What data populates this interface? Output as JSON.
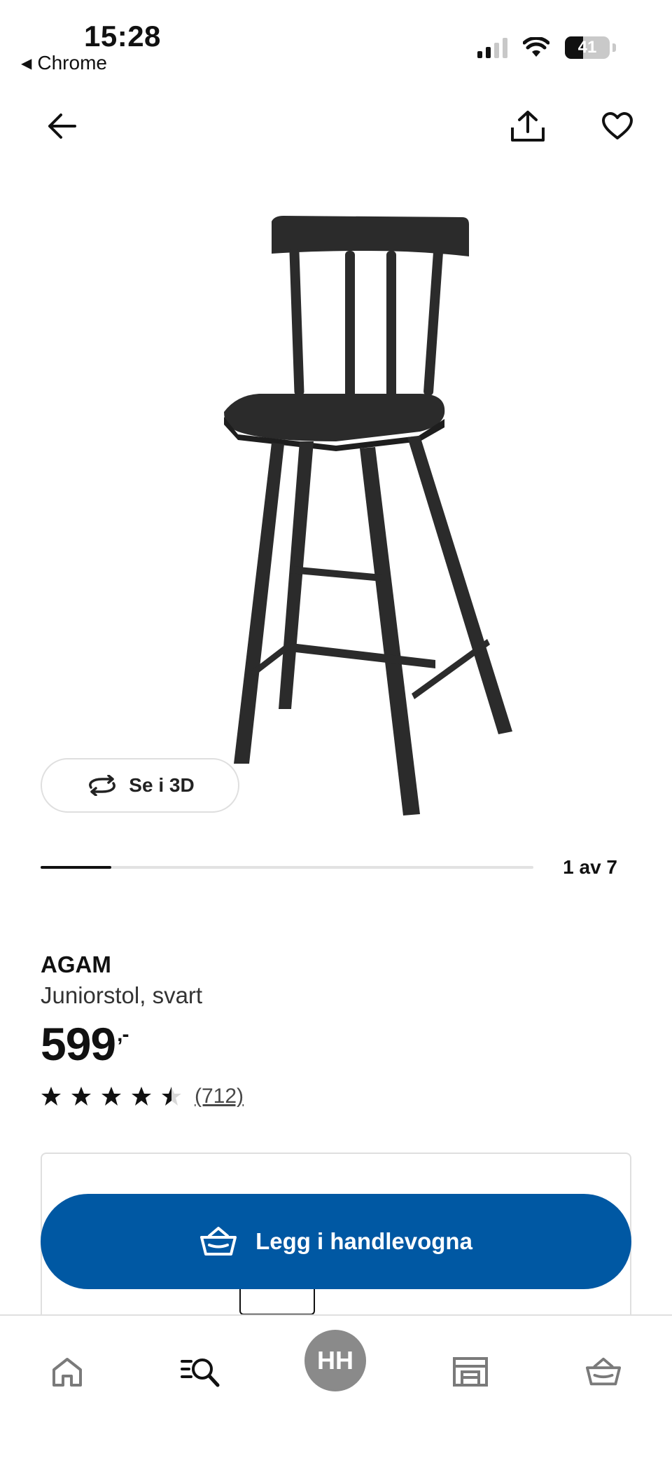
{
  "status_bar": {
    "time": "15:28",
    "back_app": "Chrome",
    "battery": "41"
  },
  "product": {
    "name": "AGAM",
    "description": "Juniorstol, svart",
    "price": "599",
    "price_suffix": ",-",
    "rating": 4.5,
    "rating_count": "(712)"
  },
  "gallery": {
    "view_3d_label": "Se i 3D",
    "counter": "1 av 7",
    "current": 1,
    "total": 7
  },
  "cta": {
    "add_to_cart_label": "Legg i handlevogna"
  },
  "bottom_nav": {
    "items": [
      "home-icon",
      "search-icon",
      "account",
      "store-icon",
      "cart-icon"
    ],
    "account_initials": "HH"
  },
  "colors": {
    "brand_blue": "#0058a3",
    "text": "#111111"
  }
}
